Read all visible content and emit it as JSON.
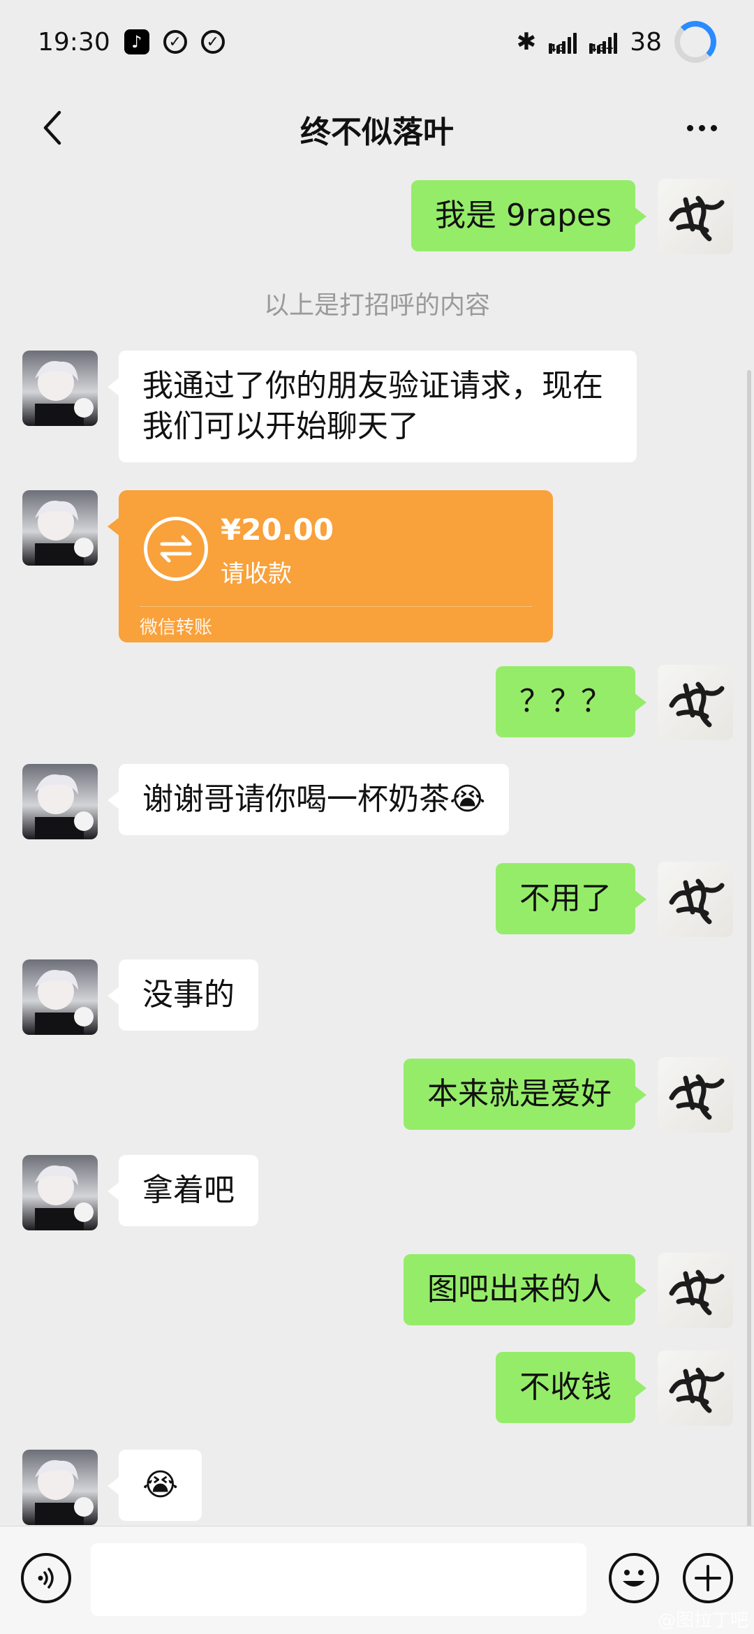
{
  "status_bar": {
    "time": "19:30",
    "battery": "38"
  },
  "header": {
    "title": "终不似落叶"
  },
  "messages": [
    {
      "side": "out",
      "text": "我是 9rapes"
    },
    {
      "type": "system",
      "text": "以上是打招呼的内容"
    },
    {
      "side": "in",
      "text": "我通过了你的朋友验证请求，现在我们可以开始聊天了"
    },
    {
      "side": "in",
      "type": "transfer",
      "amount": "¥20.00",
      "status": "请收款",
      "label": "微信转账"
    },
    {
      "side": "out",
      "text": "？？？"
    },
    {
      "side": "in",
      "text": "谢谢哥请你喝一杯奶茶😭"
    },
    {
      "side": "out",
      "text": "不用了"
    },
    {
      "side": "in",
      "text": "没事的"
    },
    {
      "side": "out",
      "text": "本来就是爱好"
    },
    {
      "side": "in",
      "text": "拿着吧"
    },
    {
      "side": "out",
      "text": "图吧出来的人"
    },
    {
      "side": "out",
      "text": "不收钱"
    },
    {
      "side": "in",
      "text": "😭"
    }
  ],
  "input": {
    "placeholder": ""
  },
  "watermark": "@图拉丁吧"
}
